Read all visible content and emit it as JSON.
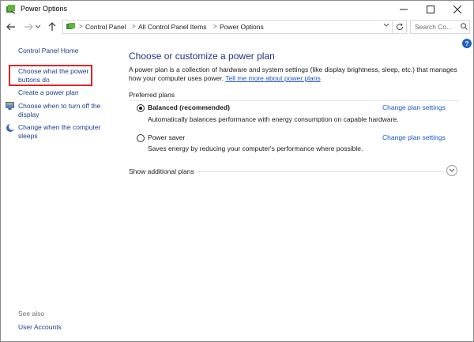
{
  "window": {
    "title": "Power Options"
  },
  "address": {
    "crumbs": [
      "Control Panel",
      "All Control Panel Items",
      "Power Options"
    ],
    "search_placeholder": "Search Co..."
  },
  "left_pane": {
    "home_link": "Control Panel Home",
    "links": [
      "Choose what the power buttons do",
      "Create a power plan",
      "Choose when to turn off the display",
      "Change when the computer sleeps"
    ],
    "see_also": "See also",
    "see_also_links": [
      "User Accounts"
    ]
  },
  "main": {
    "title": "Choose or customize a power plan",
    "intro_text": "A power plan is a collection of hardware and system settings (like display brightness, sleep, etc.) that manages how your computer uses power.",
    "intro_link": "Tell me more about power plans",
    "preferred_label": "Preferred plans",
    "plans": [
      {
        "name": "Balanced (recommended)",
        "description": "Automatically balances performance with energy consumption on capable hardware.",
        "link": "Change plan settings",
        "selected": true
      },
      {
        "name": "Power saver",
        "description": "Saves energy by reducing your computer's performance where possible.",
        "link": "Change plan settings",
        "selected": false
      }
    ],
    "show_additional": "Show additional plans"
  },
  "colors": {
    "link": "#1a56c4",
    "title": "#1e3287",
    "highlight": "#e2242a"
  }
}
